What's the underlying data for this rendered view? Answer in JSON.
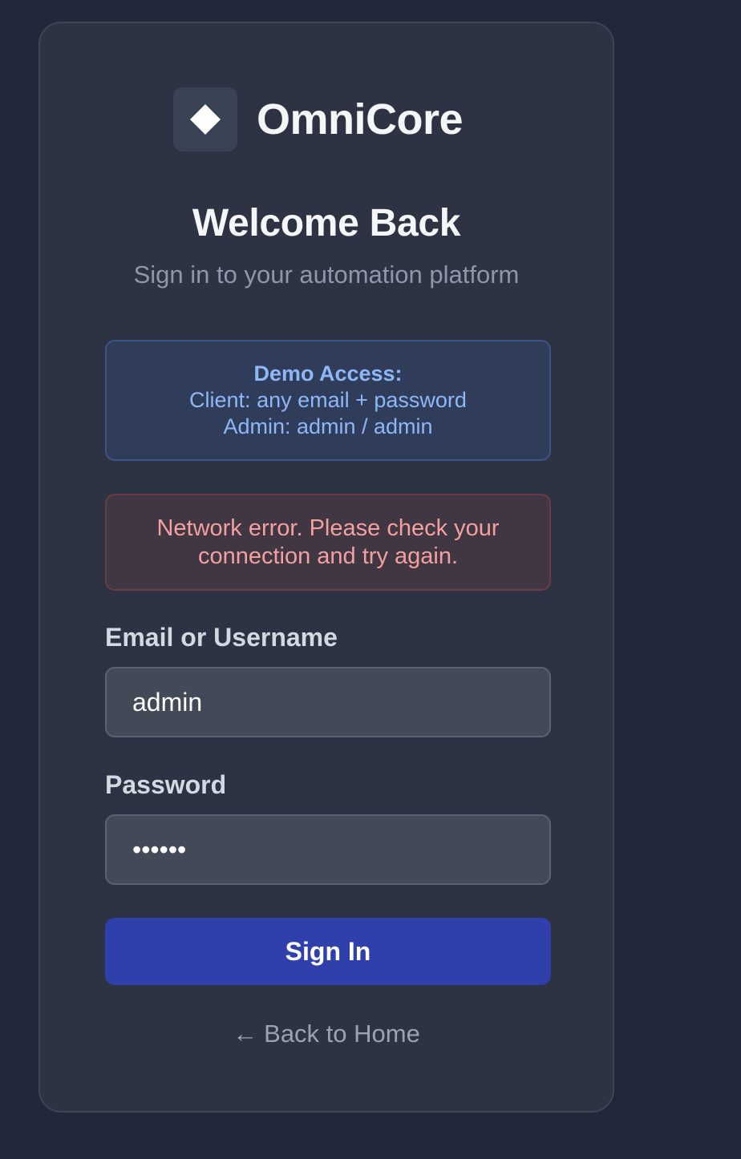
{
  "brand": {
    "name": "OmniCore",
    "logo_icon": "diamond-icon"
  },
  "header": {
    "title": "Welcome Back",
    "subtitle": "Sign in to your automation platform"
  },
  "demo": {
    "heading": "Demo Access:",
    "client_line": "Client: any email + password",
    "admin_line": "Admin: admin / admin"
  },
  "error": {
    "message": "Network error. Please check your connection and try again."
  },
  "form": {
    "email_label": "Email or Username",
    "email_value": "admin",
    "password_label": "Password",
    "password_value": "••••••",
    "submit_label": "Sign In"
  },
  "footer": {
    "back_arrow": "←",
    "back_label": "Back to Home"
  },
  "colors": {
    "background": "#22273a",
    "card": "#2d3343",
    "accent_button": "#2f40ad",
    "demo_text": "#8fb7f7",
    "error_text": "#f2a0a0"
  }
}
